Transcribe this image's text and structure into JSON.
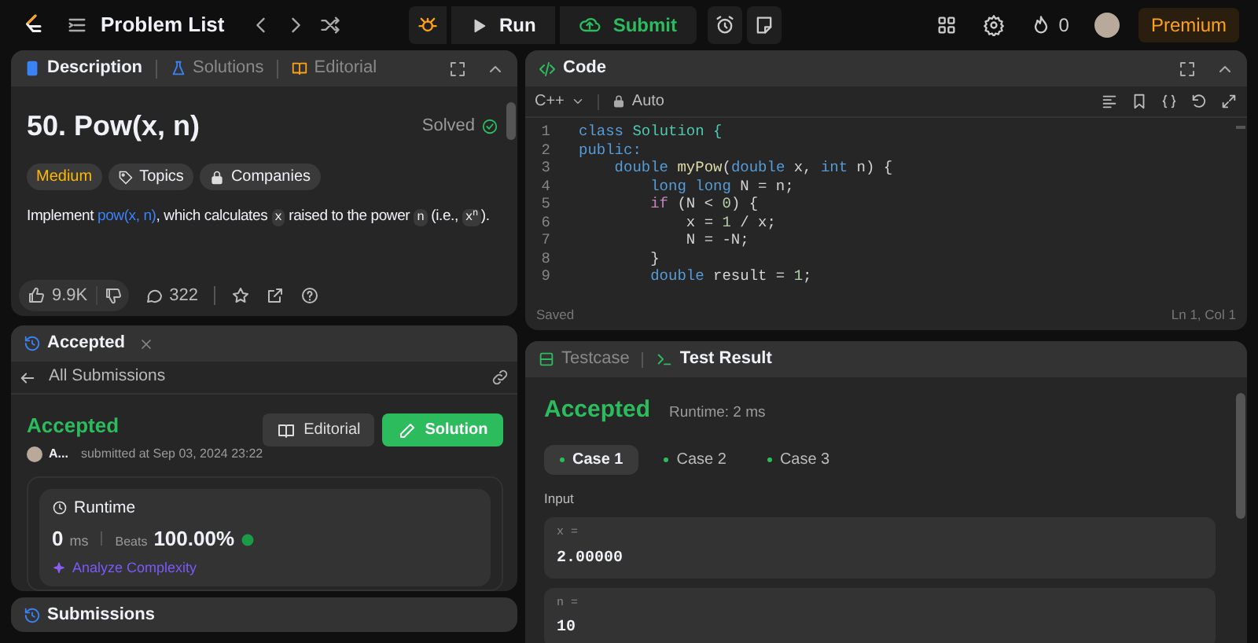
{
  "top_bar": {
    "nav_label": "Problem List",
    "run": "Run",
    "submit": "Submit",
    "streak": "0",
    "premium": "Premium"
  },
  "description_panel": {
    "tabs": [
      {
        "label": "Description",
        "selected": true
      },
      {
        "label": "Solutions",
        "selected": false
      },
      {
        "label": "Editorial",
        "selected": false
      }
    ],
    "title": "50. Pow(x, n)",
    "status": "Solved",
    "tags": [
      {
        "label": "Medium",
        "kind": "difficulty"
      },
      {
        "label": "Topics",
        "kind": "topics"
      },
      {
        "label": "Companies",
        "kind": "companies"
      }
    ],
    "statement": [
      {
        "text": "Implement ",
        "kind": "text"
      },
      {
        "text": "pow(x, n)",
        "kind": "link"
      },
      {
        "text": ", which calculates ",
        "kind": "text"
      },
      {
        "text": "x",
        "kind": "code"
      },
      {
        "text": " raised to the power ",
        "kind": "text"
      },
      {
        "text": "n",
        "kind": "code"
      },
      {
        "text": " (i.e., ",
        "kind": "text"
      },
      {
        "text": "x$^{n}$",
        "kind": "code"
      },
      {
        "text": ").",
        "kind": "text"
      }
    ],
    "likes": "9.9K",
    "comments": "322"
  },
  "accepted_panel": {
    "tab": "Accepted",
    "back": "All Submissions",
    "status": "Accepted",
    "user": "A...",
    "submitted": "submitted at Sep 03, 2024 23:22",
    "editorial_button": "Editorial",
    "solution_button": "Solution",
    "runtime": {
      "label": "Runtime",
      "value": "0",
      "unit": "ms",
      "beats_label": "Beats",
      "beats": "100.00%",
      "analyze": "Analyze Complexity"
    }
  },
  "submissions_bar": {
    "title": "Submissions"
  },
  "code_panel": {
    "title": "Code",
    "language": "C++",
    "mode": "Auto",
    "lines": [
      {
        "number": "1",
        "tokens": [
          {
            "text": "class ",
            "kind": "keyword"
          },
          {
            "text": "Solution {",
            "kind": "type"
          }
        ]
      },
      {
        "number": "2",
        "tokens": [
          {
            "text": "public:",
            "kind": "keyword"
          }
        ]
      },
      {
        "number": "3",
        "tokens": [
          {
            "text": "    double ",
            "kind": "keyword"
          },
          {
            "text": "myPow",
            "kind": "function"
          },
          {
            "text": "(",
            "kind": "plain"
          },
          {
            "text": "double ",
            "kind": "keyword"
          },
          {
            "text": "x, ",
            "kind": "plain"
          },
          {
            "text": "int ",
            "kind": "keyword"
          },
          {
            "text": "n) {",
            "kind": "plain"
          }
        ]
      },
      {
        "number": "4",
        "tokens": [
          {
            "text": "        long long ",
            "kind": "keyword"
          },
          {
            "text": "N = n;",
            "kind": "plain"
          }
        ]
      },
      {
        "number": "5",
        "tokens": [
          {
            "text": "        if ",
            "kind": "control"
          },
          {
            "text": "(N < ",
            "kind": "plain"
          },
          {
            "text": "0",
            "kind": "number"
          },
          {
            "text": ") {",
            "kind": "plain"
          }
        ]
      },
      {
        "number": "6",
        "tokens": [
          {
            "text": "            x = ",
            "kind": "plain"
          },
          {
            "text": "1",
            "kind": "number"
          },
          {
            "text": " / x;",
            "kind": "plain"
          }
        ]
      },
      {
        "number": "7",
        "tokens": [
          {
            "text": "            N = -N;",
            "kind": "plain"
          }
        ]
      },
      {
        "number": "8",
        "tokens": [
          {
            "text": "        }",
            "kind": "plain"
          }
        ]
      },
      {
        "number": "9",
        "tokens": [
          {
            "text": "        double ",
            "kind": "keyword"
          },
          {
            "text": "result = ",
            "kind": "plain"
          },
          {
            "text": "1",
            "kind": "number"
          },
          {
            "text": ";",
            "kind": "plain"
          }
        ]
      }
    ],
    "save_status": "Saved",
    "cursor": "Ln 1, Col 1"
  },
  "test_panel": {
    "tabs": [
      {
        "label": "Testcase",
        "selected": false
      },
      {
        "label": "Test Result",
        "selected": true
      }
    ],
    "verdict": "Accepted",
    "runtime": "Runtime: 2 ms",
    "cases": [
      {
        "label": "Case 1",
        "selected": true
      },
      {
        "label": "Case 2",
        "selected": false
      },
      {
        "label": "Case 3",
        "selected": false
      }
    ],
    "input_label": "Input",
    "inputs": [
      {
        "name": "x =",
        "value": "2.00000"
      },
      {
        "name": "n =",
        "value": "10"
      }
    ]
  }
}
